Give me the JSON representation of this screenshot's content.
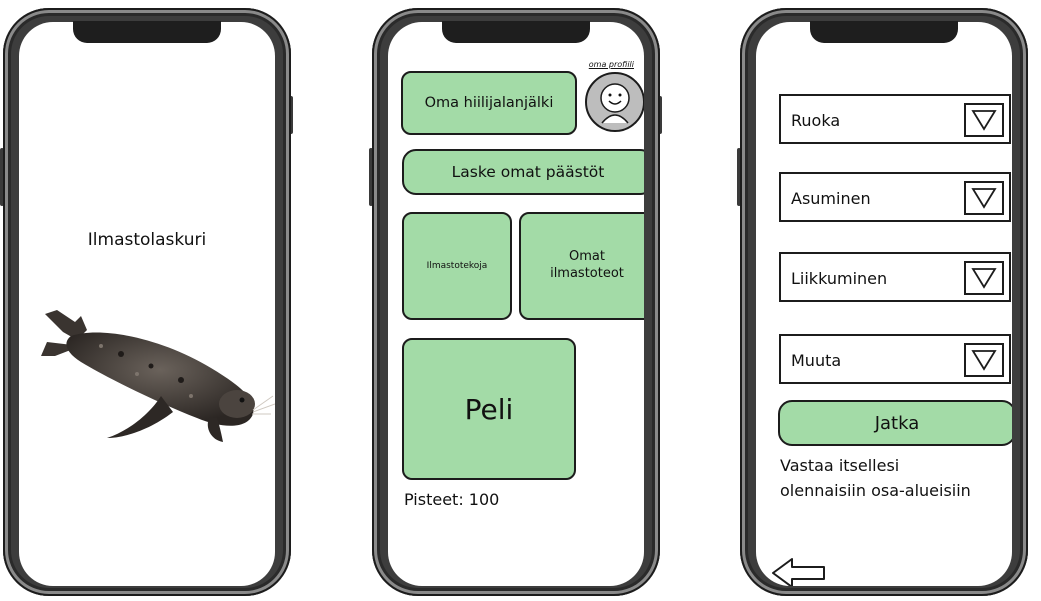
{
  "screen1": {
    "title": "Ilmastolaskuri"
  },
  "screen2": {
    "profile_link": "oma profiili",
    "carbon_footprint_button": "Oma hiilijalanjälki",
    "calculate_button": "Laske omat päästöt",
    "climate_deeds_button": "Ilmastotekoja",
    "my_climate_deeds_button": "Omat\nilmastoteot",
    "game_button": "Peli",
    "points": "Pisteet: 100"
  },
  "screen3": {
    "dropdowns": [
      {
        "label": "Ruoka"
      },
      {
        "label": "Asuminen"
      },
      {
        "label": "Liikkuminen"
      },
      {
        "label": "Muuta"
      }
    ],
    "continue_button": "Jatka",
    "instruction": "Vastaa itsellesi\nolennaisiin osa-alueisiin"
  },
  "colors": {
    "button_green": "#a3dba7",
    "phone_frame": "#3d3d3d"
  },
  "icons": [
    "avatar-icon",
    "dropdown-arrow-icon",
    "back-arrow-icon",
    "seal-image"
  ]
}
